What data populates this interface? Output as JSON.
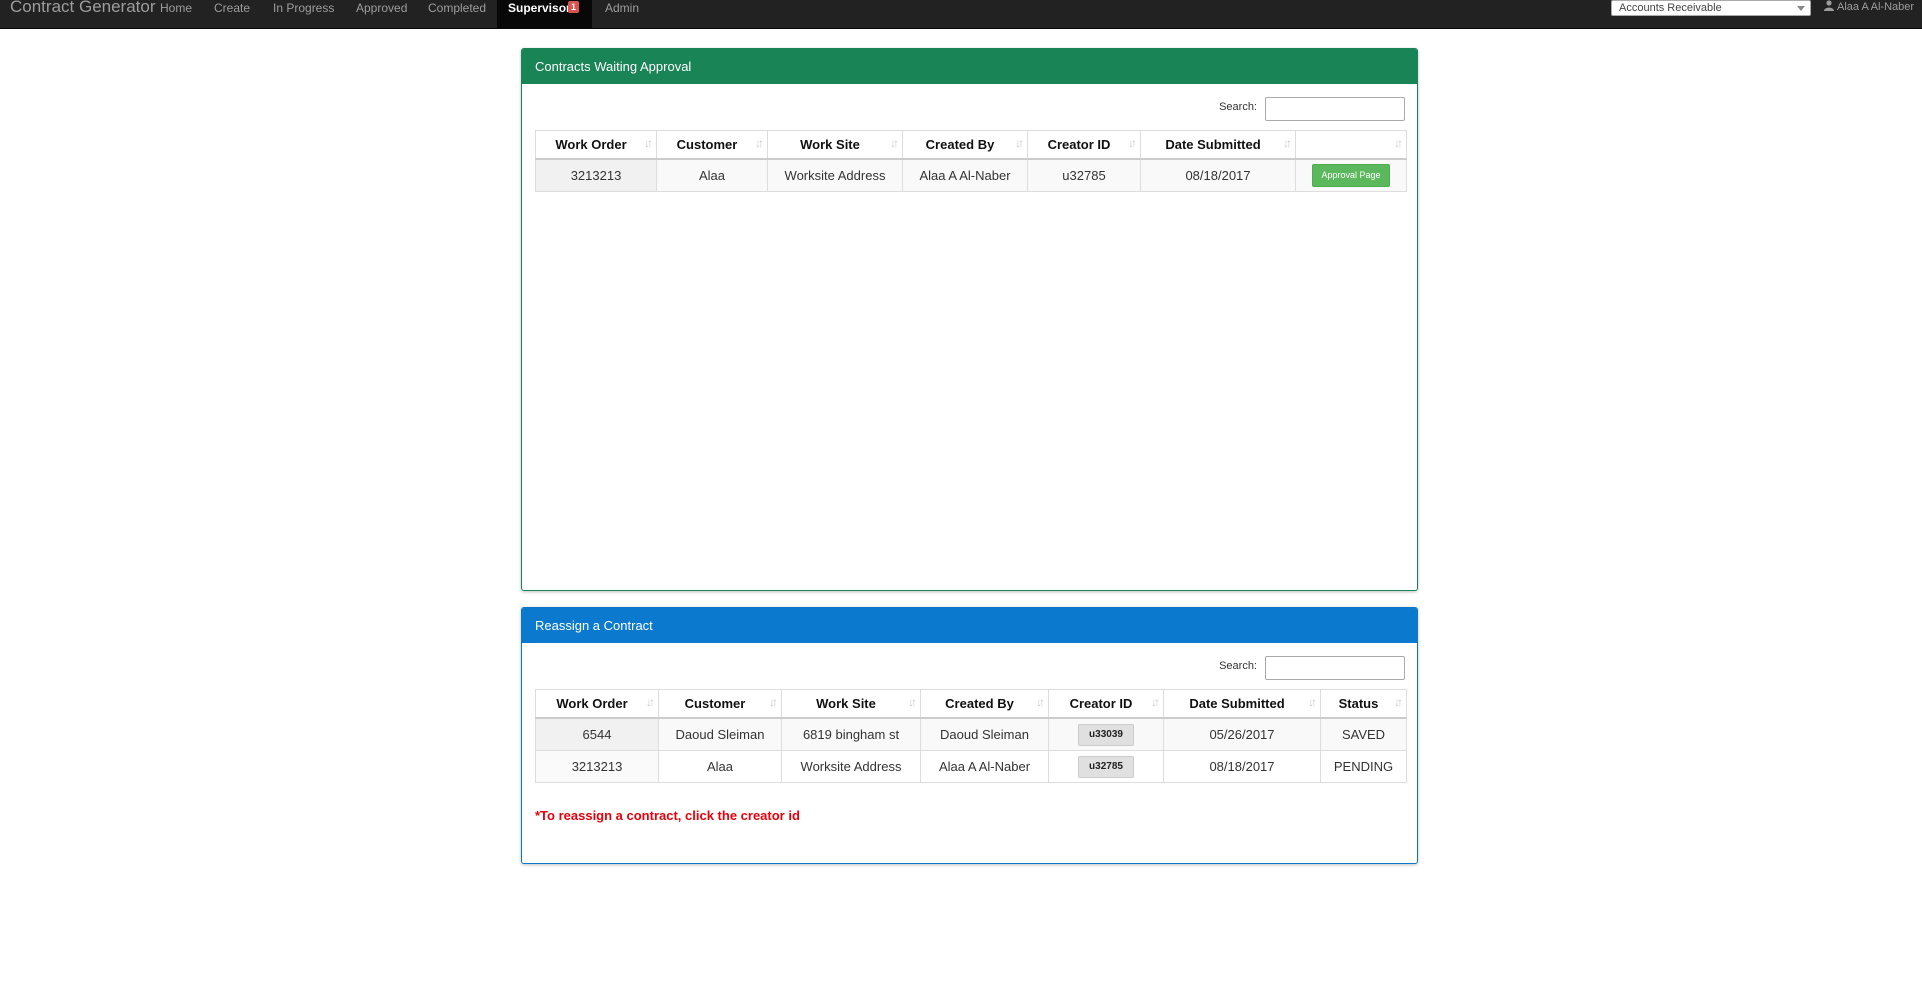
{
  "navbar": {
    "brand": "Contract Generator",
    "items": [
      {
        "label": "Home"
      },
      {
        "label": "Create"
      },
      {
        "label": "In Progress"
      },
      {
        "label": "Approved"
      },
      {
        "label": "Completed"
      },
      {
        "label": "Supervisor",
        "badge": "1",
        "active": true
      },
      {
        "label": "Admin"
      }
    ],
    "department_select": "Accounts Receivable",
    "user_name": "Alaa A Al-Naber"
  },
  "approval_panel": {
    "title": "Contracts Waiting Approval",
    "search_label": "Search:",
    "columns": [
      "Work Order",
      "Customer",
      "Work Site",
      "Created By",
      "Creator ID",
      "Date Submitted",
      ""
    ],
    "rows": [
      {
        "work_order": "3213213",
        "customer": "Alaa",
        "work_site": "Worksite Address",
        "created_by": "Alaa A Al-Naber",
        "creator_id": "u32785",
        "date_submitted": "08/18/2017",
        "action": "Approval Page"
      }
    ]
  },
  "reassign_panel": {
    "title": "Reassign a Contract",
    "search_label": "Search:",
    "columns": [
      "Work Order",
      "Customer",
      "Work Site",
      "Created By",
      "Creator ID",
      "Date Submitted",
      "Status"
    ],
    "rows": [
      {
        "work_order": "6544",
        "customer": "Daoud Sleiman",
        "work_site": "6819 bingham st",
        "created_by": "Daoud Sleiman",
        "creator_id": "u33039",
        "date_submitted": "05/26/2017",
        "status": "SAVED"
      },
      {
        "work_order": "3213213",
        "customer": "Alaa",
        "work_site": "Worksite Address",
        "created_by": "Alaa A Al-Naber",
        "creator_id": "u32785",
        "date_submitted": "08/18/2017",
        "status": "PENDING"
      }
    ],
    "note": "*To reassign a contract, click the creator id"
  },
  "colors": {
    "navbar": "#222222",
    "approval_header": "#198456",
    "reassign_header": "#0b79cd",
    "approve_button": "#5cb85c",
    "note_text": "#e8000b",
    "badge": "#d9534f"
  }
}
